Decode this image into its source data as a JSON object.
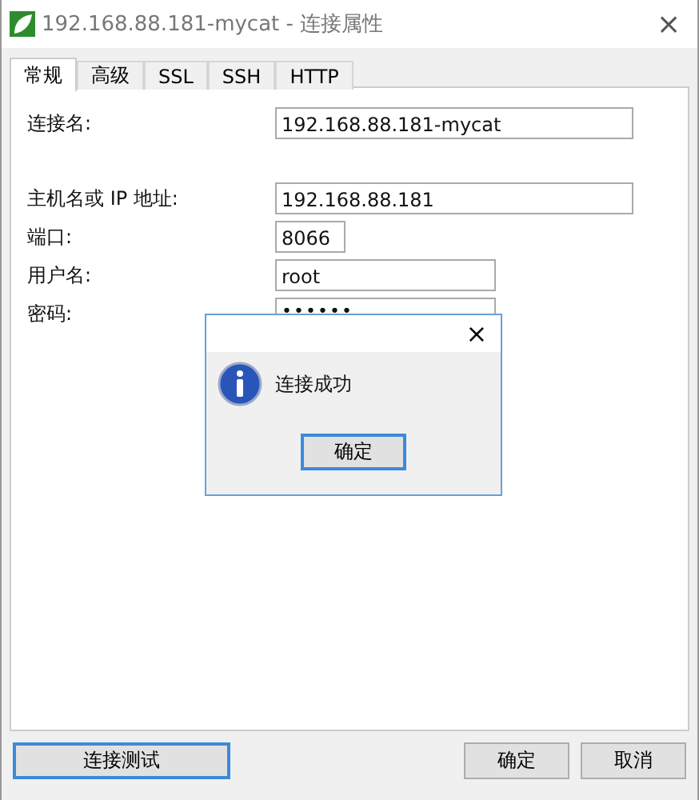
{
  "window": {
    "title": "192.168.88.181-mycat - 连接属性",
    "close": "×"
  },
  "tabs": [
    {
      "label": "常规",
      "selected": true
    },
    {
      "label": "高级",
      "selected": false
    },
    {
      "label": "SSL",
      "selected": false
    },
    {
      "label": "SSH",
      "selected": false
    },
    {
      "label": "HTTP",
      "selected": false
    }
  ],
  "fields": [
    {
      "label": "连接名:",
      "value": "192.168.88.181-mycat"
    },
    {
      "label": "主机名或 IP 地址:",
      "value": "192.168.88.181"
    },
    {
      "label": "端口:",
      "value": "8066"
    },
    {
      "label": "用户名:",
      "value": "root"
    },
    {
      "label": "密码:",
      "value": "••••••"
    }
  ],
  "message_box": {
    "close": "×",
    "message": "连接成功",
    "button": "确定"
  },
  "buttons": [
    {
      "label": "连接测试",
      "focused": true
    },
    {
      "label": "确定",
      "focused": false
    },
    {
      "label": "取消",
      "focused": false
    }
  ]
}
